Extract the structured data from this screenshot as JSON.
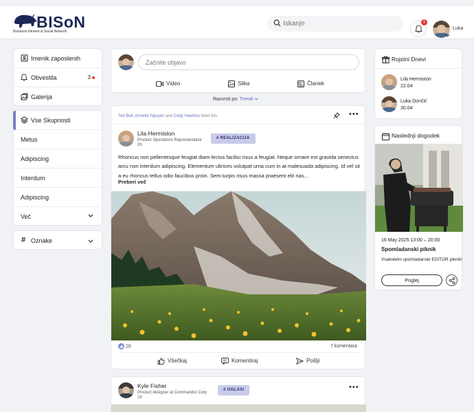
{
  "brand": {
    "name": "BISoN",
    "tagline": "Business Intranet & Social Network"
  },
  "search": {
    "placeholder": "Iskanje"
  },
  "notifications": {
    "count": "1"
  },
  "user": {
    "name": "Luka"
  },
  "left_menu": {
    "items": [
      {
        "label": "Imenik zaposlenih",
        "icon": "contacts-icon"
      },
      {
        "label": "Obvestila",
        "icon": "bell-icon",
        "count": "3"
      },
      {
        "label": "Galerija",
        "icon": "gallery-icon"
      }
    ]
  },
  "groups": {
    "header": "Vse Skupnosti",
    "items": [
      "Metus",
      "Adipiscing",
      "Interdum",
      "Adipiscing"
    ],
    "more": "Več"
  },
  "tags_menu": {
    "label": "Oznake"
  },
  "composer": {
    "placeholder": "Začnite objavo",
    "actions": [
      {
        "label": "Video",
        "icon": "video-icon"
      },
      {
        "label": "Slika",
        "icon": "image-icon"
      },
      {
        "label": "Članek",
        "icon": "article-icon"
      }
    ]
  },
  "sort": {
    "label": "Razvrsti po:",
    "value": "Trendi"
  },
  "post1": {
    "liked_by_1": "Ted Bell",
    "liked_by_sep": ", ",
    "liked_by_2": "Annette Nguyen",
    "liked_by_and": " and ",
    "liked_by_3": "Cody Hawkins",
    "liked_suffix": " liked this",
    "author": "Lila Hermiston",
    "role": "Product Operations Representative",
    "time": "2h",
    "tag": "# REALIZACIJA",
    "text": "Rhoncus non pellentesque feugiat diam lectus facilisi risus a feugiat. Neque ornare est gravida senectus arcu non interdum adipiscing. Elementum ultrices volutpat urna cum in at malesuada adipiscing. Id vel sit a eu rhoncus tellus odio faucibus proin. Sem turpis risus massa praesent elit nas...",
    "read_more": "Preberi več",
    "likes": "20",
    "comments": "7 komentara",
    "actions": {
      "like": "Všečkaj",
      "comment": "Komentiraj",
      "send": "Pošlji"
    }
  },
  "post2": {
    "author": "Kyle Fisher",
    "role": "Product designer at Commandor Corp",
    "time": "2d",
    "tag": "# OGLASI"
  },
  "birthdays": {
    "title": "Rojstni Dnevi",
    "people": [
      {
        "name": "Lila Hermiston",
        "date": "22.04"
      },
      {
        "name": "Luka Dončić",
        "date": "30.04"
      }
    ]
  },
  "event": {
    "title_section": "Naslednji dogodek",
    "date": "16 May 2025 13:00 – 20:00",
    "title": "Spomladanski piknik",
    "description": "Vsakoletni spomladanski EDITOR piknik!",
    "button": "Poglej"
  },
  "colors": {
    "accent": "#5b6dcc",
    "tag_bg": "#c9cbeb",
    "badge": "#e53935",
    "brand": "#1d2757"
  }
}
